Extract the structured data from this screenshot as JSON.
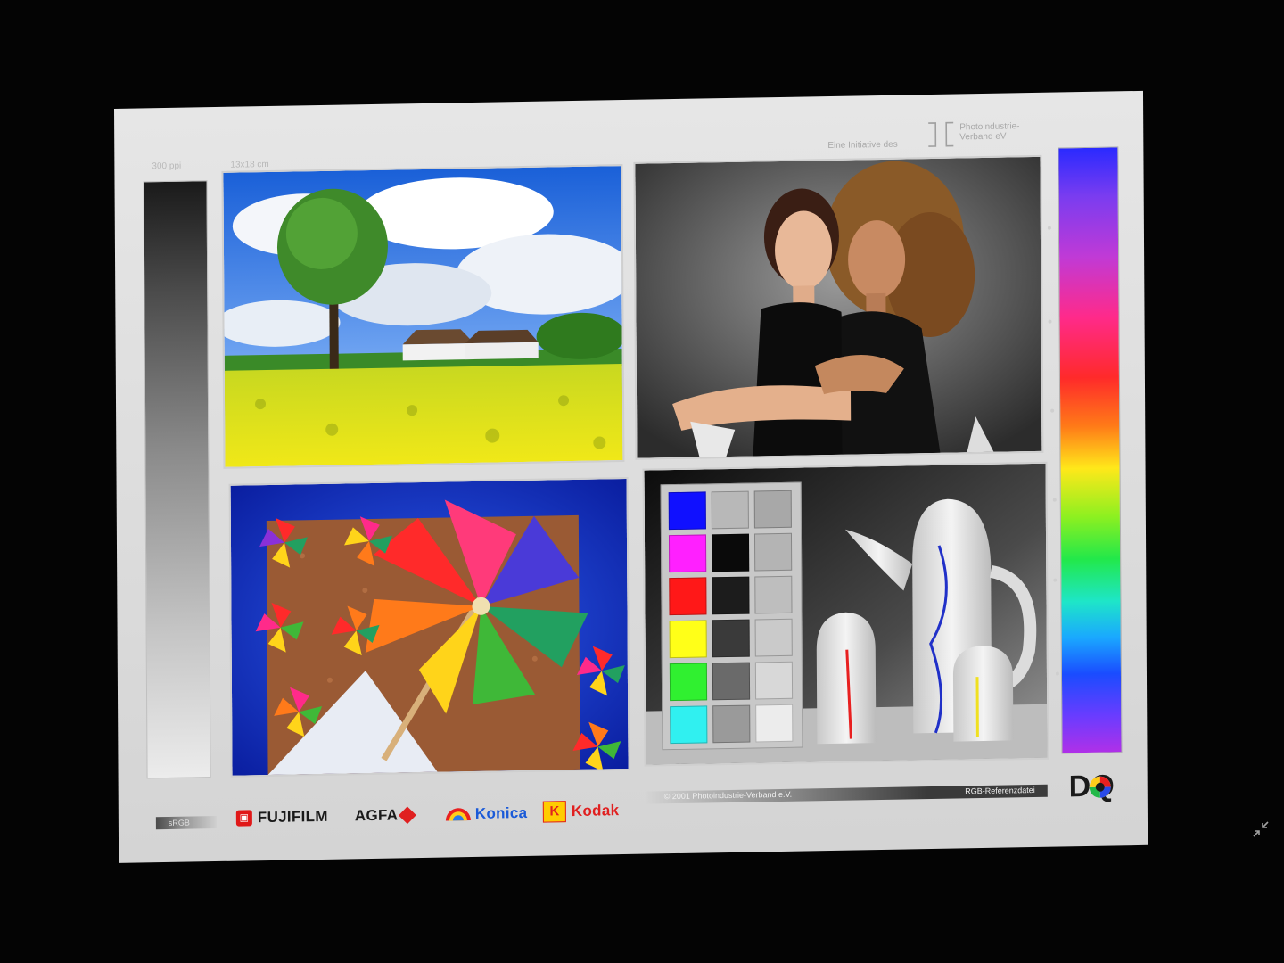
{
  "header": {
    "resolution": "300 ppi",
    "print_size": "13x18 cm",
    "initiative_text": "Eine Initiative des",
    "association_name": "Photoindustrie-\nVerband eV"
  },
  "footer": {
    "color_space": "sRGB",
    "brands": [
      "FUJIFILM",
      "AGFA",
      "Konica",
      "Kodak"
    ],
    "copyright": "© 2001  Photoindustrie-Verband e.V.",
    "file_label": "RGB-Referenzdatei",
    "dq_logo": "DQ"
  },
  "colors": {
    "patches_col1": [
      "#1010ff",
      "#ff20ff",
      "#ff1818",
      "#ffff18",
      "#30f030",
      "#30f0f0"
    ],
    "patches_col2": [
      "#b8b8b8",
      "#0a0a0a",
      "#1c1c1c",
      "#3a3a3a",
      "#6a6a6a",
      "#9a9a9a"
    ],
    "patches_col3": [
      "#a8a8a8",
      "#b4b4b4",
      "#bebebe",
      "#cacaca",
      "#d8d8d8",
      "#ececec"
    ]
  },
  "icons": [
    "fujifilm-logo-icon",
    "agfa-rhombus-icon",
    "konica-rainbow-icon",
    "kodak-k-icon",
    "dq-color-wheel-icon",
    "collapse-arrows-icon"
  ]
}
